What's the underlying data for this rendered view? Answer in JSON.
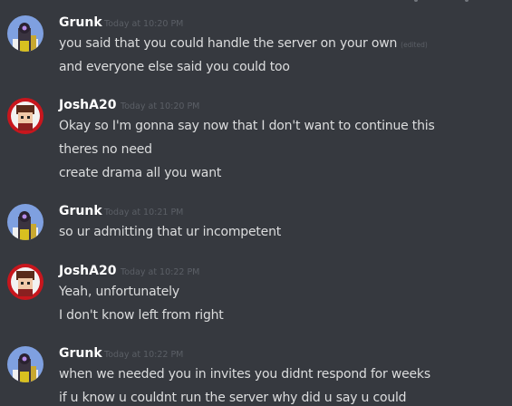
{
  "messages": [
    {
      "author": "Grunk",
      "timestamp": "Today at 10:20 PM",
      "avatar": "grunk-avatar",
      "lines": [
        {
          "text": "you said that you could handle the server on your own",
          "edited": "(edited)"
        },
        {
          "text": "and everyone else said you could too"
        }
      ]
    },
    {
      "author": "JoshA20",
      "timestamp": "Today at 10:20 PM",
      "avatar": "josh-avatar",
      "lines": [
        {
          "text": "Okay so I'm gonna say now that I don't want to continue this"
        },
        {
          "text": "theres no need"
        },
        {
          "text": "create drama all you want"
        }
      ]
    },
    {
      "author": "Grunk",
      "timestamp": "Today at 10:21 PM",
      "avatar": "grunk-avatar",
      "lines": [
        {
          "text": "so ur admitting that ur incompetent"
        }
      ]
    },
    {
      "author": "JoshA20",
      "timestamp": "Today at 10:22 PM",
      "avatar": "josh-avatar",
      "lines": [
        {
          "text": "Yeah, unfortunately"
        },
        {
          "text": "I don't know left from right"
        }
      ]
    },
    {
      "author": "Grunk",
      "timestamp": "Today at 10:22 PM",
      "avatar": "grunk-avatar",
      "lines": [
        {
          "text": "when we needed you in invites you didnt respond for weeks"
        },
        {
          "text": "if u know u couldnt run the server why did u say u could"
        }
      ]
    }
  ],
  "colors": {
    "background": "#36393f",
    "username": "#ffffff",
    "message_text": "#dcddde",
    "timestamp": "#5b5f66",
    "grunk_avatar_bg": "#7fa0e0",
    "josh_avatar_bg": "#c8161d"
  }
}
